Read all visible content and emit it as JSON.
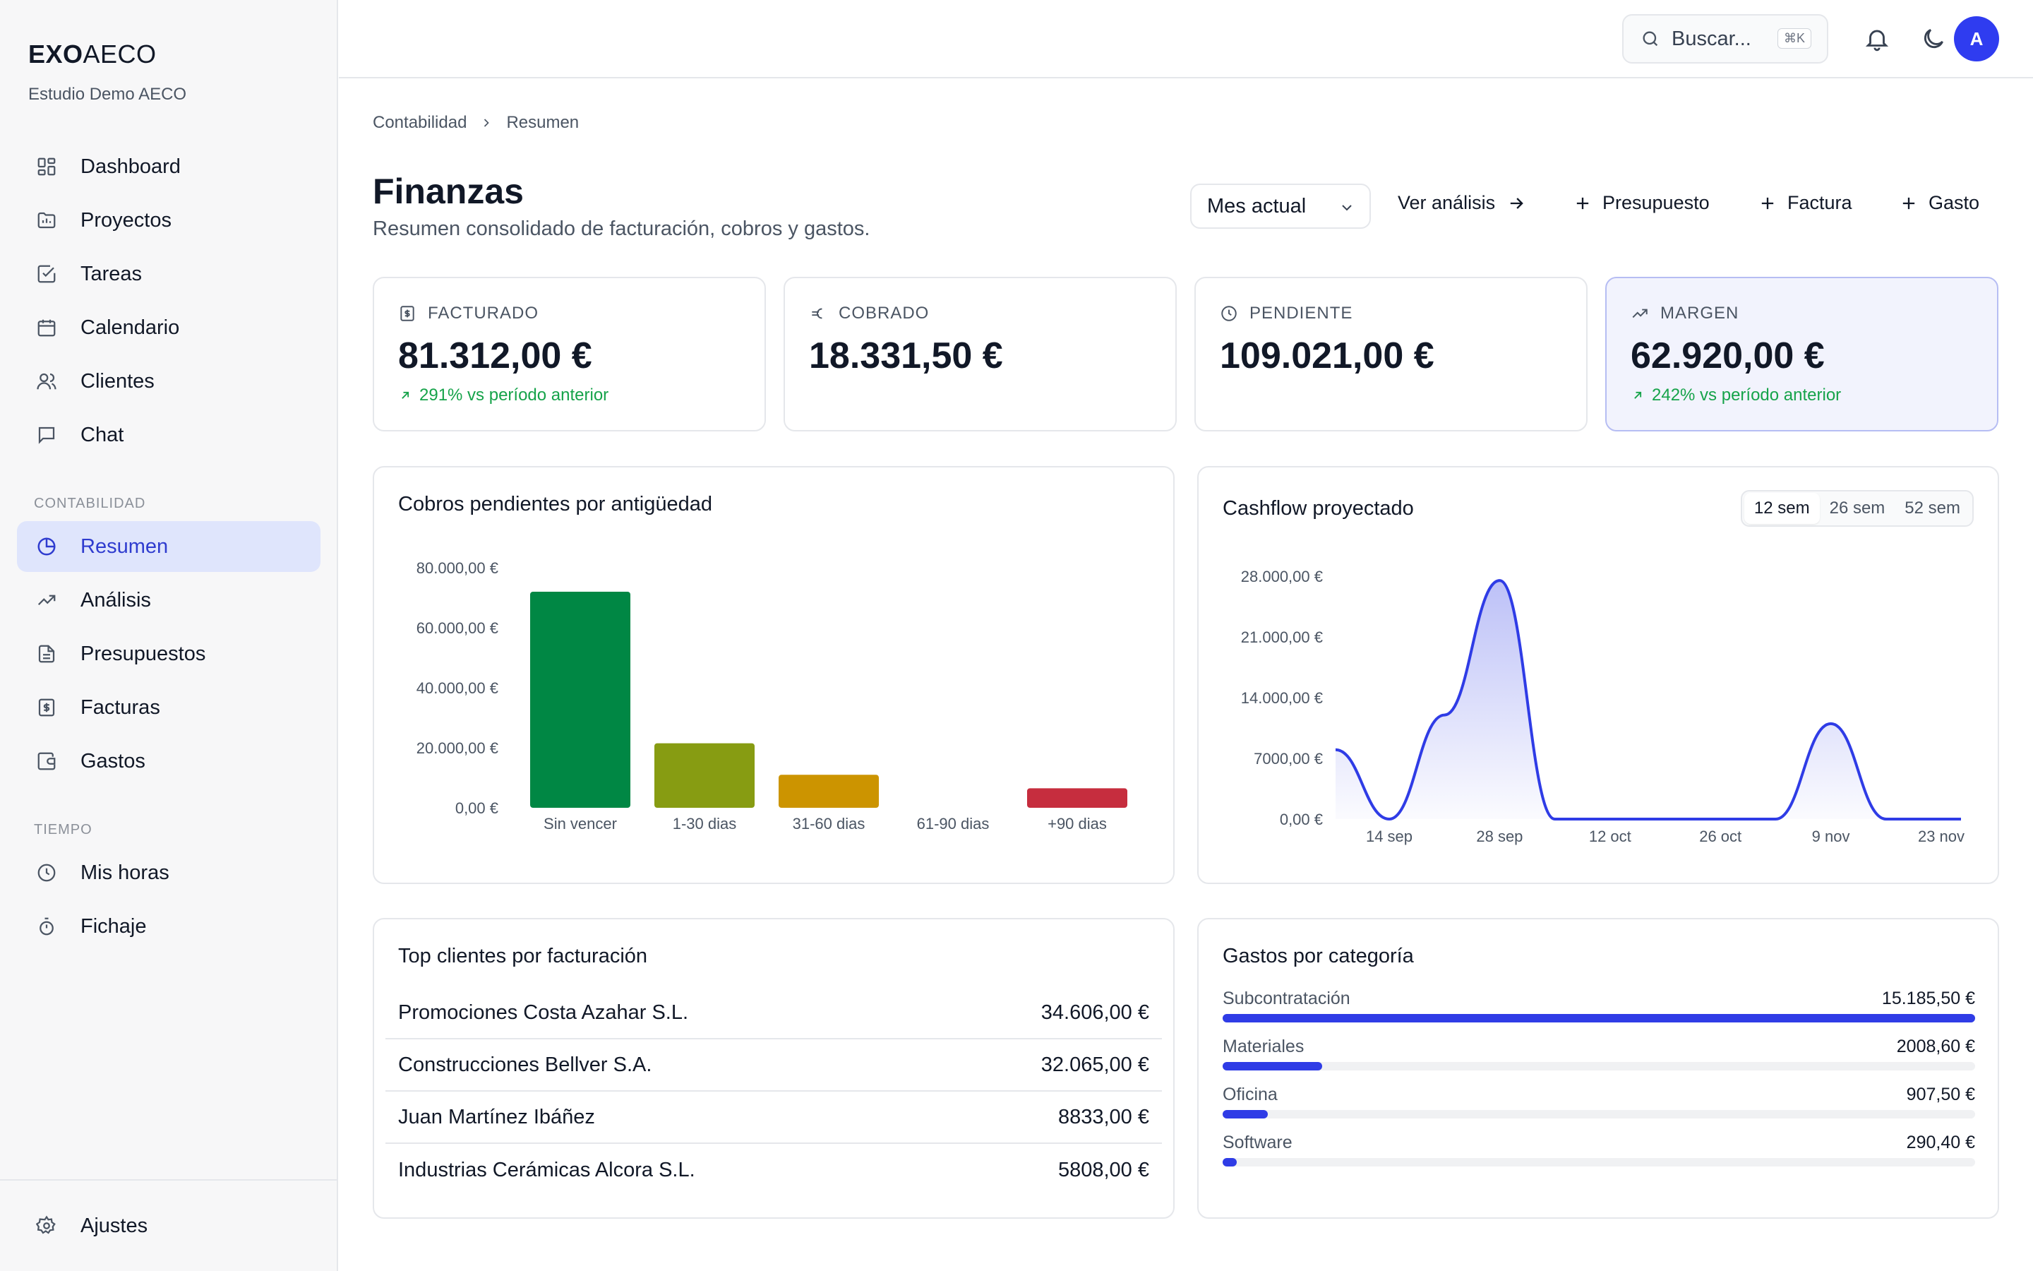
{
  "brand": {
    "bold": "EXO",
    "light": "AECO",
    "org": "Estudio Demo AECO"
  },
  "nav": {
    "main": [
      {
        "label": "Dashboard",
        "icon": "dashboard-icon"
      },
      {
        "label": "Proyectos",
        "icon": "folder-icon"
      },
      {
        "label": "Tareas",
        "icon": "checkbox-icon"
      },
      {
        "label": "Calendario",
        "icon": "calendar-icon"
      },
      {
        "label": "Clientes",
        "icon": "users-icon"
      },
      {
        "label": "Chat",
        "icon": "chat-icon"
      }
    ],
    "section_contabilidad": "CONTABILIDAD",
    "contabilidad": [
      {
        "label": "Resumen",
        "icon": "pie-chart-icon",
        "active": true
      },
      {
        "label": "Análisis",
        "icon": "trending-up-icon"
      },
      {
        "label": "Presupuestos",
        "icon": "document-icon"
      },
      {
        "label": "Facturas",
        "icon": "invoice-icon"
      },
      {
        "label": "Gastos",
        "icon": "wallet-icon"
      }
    ],
    "section_tiempo": "TIEMPO",
    "tiempo": [
      {
        "label": "Mis horas",
        "icon": "clock-icon"
      },
      {
        "label": "Fichaje",
        "icon": "stopwatch-icon"
      }
    ],
    "bottom": {
      "label": "Ajustes",
      "icon": "gear-icon"
    }
  },
  "header": {
    "search_placeholder": "Buscar...",
    "search_shortcut": "⌘K",
    "avatar_initial": "A"
  },
  "breadcrumb": [
    "Contabilidad",
    "Resumen"
  ],
  "page": {
    "title": "Finanzas",
    "subtitle": "Resumen consolidado de facturación, cobros y gastos.",
    "period_select": "Mes actual",
    "actions": {
      "analysis": "Ver análisis",
      "budget": "Presupuesto",
      "invoice": "Factura",
      "expense": "Gasto"
    }
  },
  "kpis": [
    {
      "label": "FACTURADO",
      "value": "81.312,00 €",
      "delta": "291% vs período anterior"
    },
    {
      "label": "COBRADO",
      "value": "18.331,50 €",
      "delta": ""
    },
    {
      "label": "PENDIENTE",
      "value": "109.021,00 €",
      "delta": ""
    },
    {
      "label": "MARGEN",
      "value": "62.920,00 €",
      "delta": "242% vs período anterior"
    }
  ],
  "colors": {
    "accent": "#2f3ce6",
    "positive": "#16a34a",
    "aging": [
      "#008744",
      "#879c12",
      "#cc9400",
      "#9ca3af",
      "#c62d3e"
    ]
  },
  "aging_card": {
    "title": "Cobros pendientes por antigüedad"
  },
  "cashflow_card": {
    "title": "Cashflow proyectado",
    "ranges": [
      "12 sem",
      "26 sem",
      "52 sem"
    ],
    "selected_range": "12 sem"
  },
  "chart_data": [
    {
      "type": "bar",
      "title": "Cobros pendientes por antigüedad",
      "categories": [
        "Sin vencer",
        "1-30 dias",
        "31-60 dias",
        "61-90 dias",
        "+90 dias"
      ],
      "values": [
        72000,
        21500,
        11000,
        0,
        6500
      ],
      "ylim": [
        0,
        80000
      ],
      "yticks": [
        "80.000,00 €",
        "60.000,00 €",
        "40.000,00 €",
        "20.000,00 €",
        "0,00 €"
      ],
      "ytick_values": [
        80000,
        60000,
        40000,
        20000,
        0
      ]
    },
    {
      "type": "area",
      "title": "Cashflow proyectado",
      "x": [
        "14 sep",
        "21 sep",
        "28 sep",
        "5 oct",
        "12 oct",
        "19 oct",
        "26 oct",
        "2 nov",
        "9 nov",
        "16 nov",
        "23 nov"
      ],
      "xticks": [
        "14 sep",
        "28 sep",
        "12 oct",
        "26 oct",
        "9 nov",
        "23 nov"
      ],
      "values": [
        0,
        12000,
        27500,
        0,
        0,
        0,
        0,
        0,
        11000,
        0,
        0
      ],
      "start_value": 8000,
      "ylim": [
        0,
        28000
      ],
      "yticks": [
        "28.000,00 €",
        "21.000,00 €",
        "14.000,00 €",
        "7000,00 €",
        "0,00 €"
      ],
      "ytick_values": [
        28000,
        21000,
        14000,
        7000,
        0
      ]
    }
  ],
  "top_clients": {
    "title": "Top clientes por facturación",
    "rows": [
      {
        "name": "Promociones Costa Azahar S.L.",
        "amount": "34.606,00 €"
      },
      {
        "name": "Construcciones Bellver S.A.",
        "amount": "32.065,00 €"
      },
      {
        "name": "Juan Martínez Ibáñez",
        "amount": "8833,00 €"
      },
      {
        "name": "Industrias Cerámicas Alcora S.L.",
        "amount": "5808,00 €"
      }
    ]
  },
  "expenses": {
    "title": "Gastos por categoría",
    "rows": [
      {
        "label": "Subcontratación",
        "value": "15.185,50 €",
        "fraction": 1.0
      },
      {
        "label": "Materiales",
        "value": "2008,60 €",
        "fraction": 0.132
      },
      {
        "label": "Oficina",
        "value": "907,50 €",
        "fraction": 0.06
      },
      {
        "label": "Software",
        "value": "290,40 €",
        "fraction": 0.019
      }
    ]
  }
}
